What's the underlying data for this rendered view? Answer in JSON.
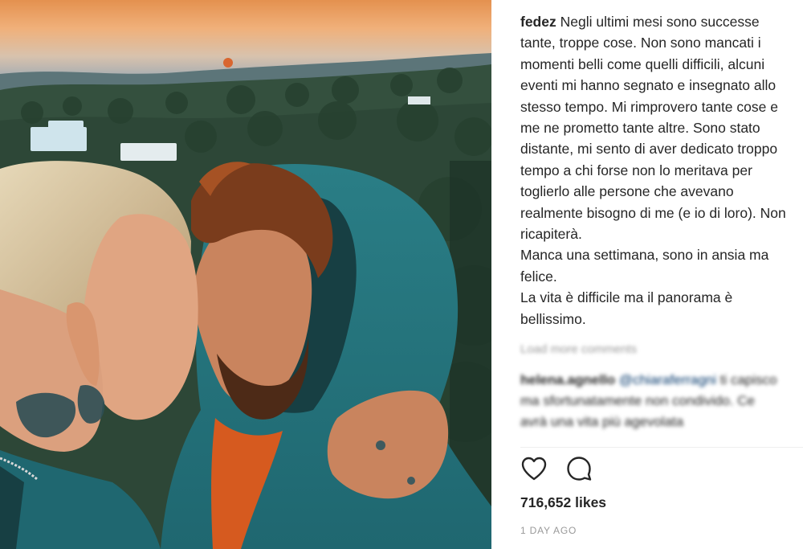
{
  "post": {
    "username": "fedez",
    "caption_lines": [
      " Negli ultimi mesi sono successe",
      "tante, troppe cose. Non sono mancati i",
      "momenti belli come quelli difficili, alcuni",
      "eventi mi hanno segnato e insegnato allo",
      "stesso tempo. Mi rimprovero tante cose e",
      "me ne prometto tante altre. Sono stato",
      "distante, mi sento di aver dedicato troppo",
      "tempo a chi forse non lo meritava per",
      "toglierlo alle persone che avevano",
      "realmente bisogno di me (e io di loro). Non",
      "ricapiterà.",
      "Manca una settimana, sono in ansia ma",
      "felice.",
      "La vita è difficile ma il panorama è",
      "bellissimo."
    ],
    "load_more_comments": "Load more comments",
    "comment": {
      "username": "helena.agnello",
      "mention": "@chiaraferragni",
      "line1_rest": " ti capisco",
      "line2": "ma sfortunatamente non condivido. Ce",
      "line3": "avrà una vita più agevolata"
    },
    "likes": "716,652 likes",
    "timestamp": "1 DAY AGO"
  },
  "icons": {
    "like": "heart-outline-icon",
    "comment": "speech-bubble-icon"
  },
  "colors": {
    "text": "#262626",
    "muted": "#999999",
    "link": "#003569",
    "divider": "#efefef"
  }
}
